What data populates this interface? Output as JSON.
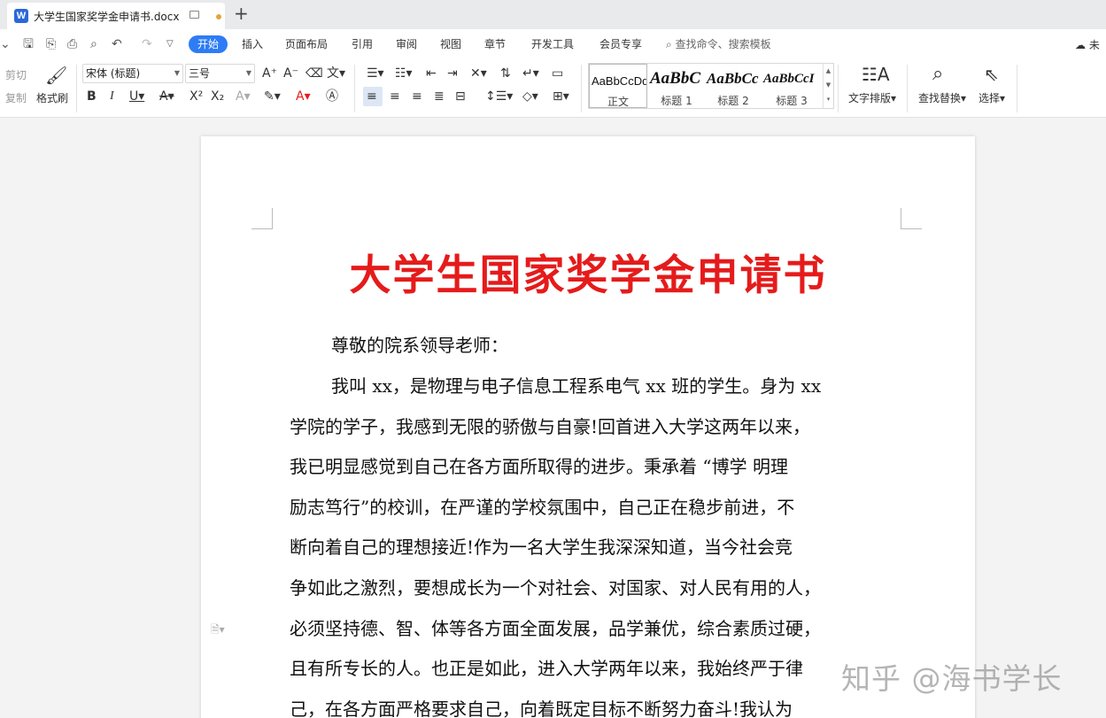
{
  "tab": {
    "title": "大学生国家奖学金申请书.docx",
    "new_tab": "+"
  },
  "menu": {
    "items": [
      "开始",
      "插入",
      "页面布局",
      "引用",
      "审阅",
      "视图",
      "章节",
      "开发工具",
      "会员专享"
    ],
    "search_placeholder": "查找命令、搜索模板",
    "cloud_label": "未"
  },
  "ribbon": {
    "cut": "剪切",
    "copy": "复制",
    "format_painter": "格式刷",
    "font_name": "宋体 (标题)",
    "font_size": "三号",
    "styles": [
      {
        "preview": "AaBbCcDd",
        "label": "正文"
      },
      {
        "preview": "AaBbC",
        "label": "标题 1"
      },
      {
        "preview": "AaBbCc",
        "label": "标题 2"
      },
      {
        "preview": "AaBbCcI",
        "label": "标题 3"
      }
    ],
    "text_layout": "文字排版",
    "find_replace": "查找替换",
    "select": "选择"
  },
  "document": {
    "title": "大学生国家奖学金申请书",
    "lines": [
      "尊敬的院系领导老师：",
      "我叫 xx，是物理与电子信息工程系电气 xx 班的学生。身为 xx",
      "学院的学子，我感到无限的骄傲与自豪!回首进入大学这两年以来，",
      "我已明显感觉到自己在各方面所取得的进步。秉承着 “博学  明理",
      "励志笃行”的校训，在严谨的学校氛围中，自己正在稳步前进，不",
      "断向着自己的理想接近!作为一名大学生我深深知道，当今社会竞",
      "争如此之激烈，要想成长为一个对社会、对国家、对人民有用的人，",
      "必须坚持德、智、体等各方面全面发展，品学兼优，综合素质过硬，",
      "且有所专长的人。也正是如此，进入大学两年以来，我始终严于律",
      "己，在各方面严格要求自己，向着既定目标不断努力奋斗!我认为"
    ]
  },
  "watermark": "知乎 @海书学长",
  "colors": {
    "accent": "#2d7cf6",
    "title_red": "#e51b1b",
    "unsaved_dot": "#e6a33a"
  }
}
